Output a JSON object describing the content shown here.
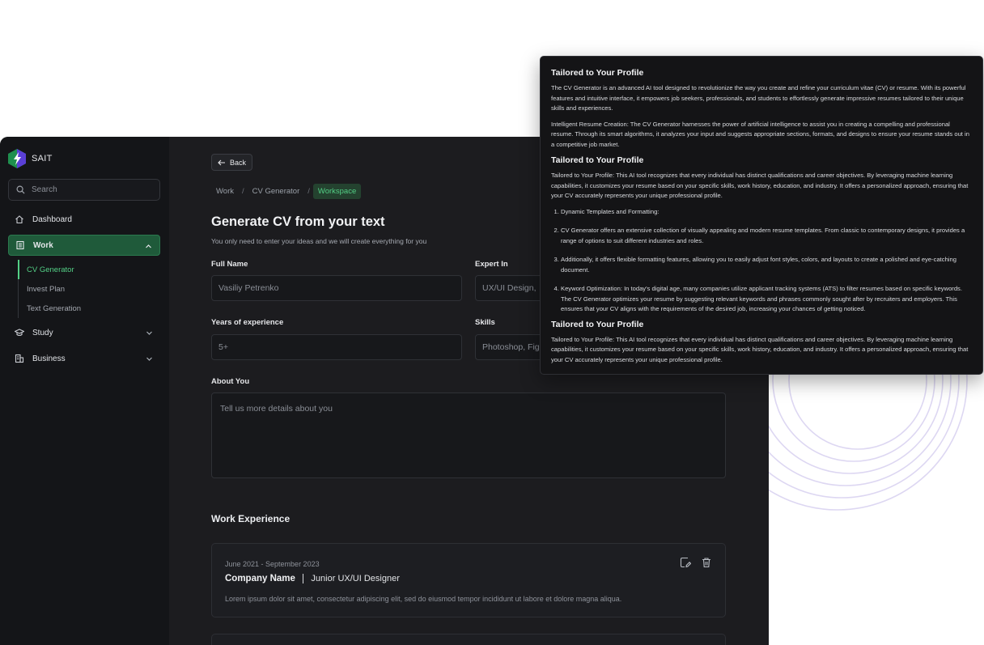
{
  "brand": {
    "name": "SAIT",
    "accent": "#53cf85"
  },
  "sidebar": {
    "search_placeholder": "Search",
    "items": [
      {
        "label": "Dashboard",
        "icon": "home-icon"
      },
      {
        "label": "Work",
        "icon": "building-icon",
        "expanded": true,
        "children": [
          {
            "label": "CV Generator",
            "active": true
          },
          {
            "label": "Invest Plan"
          },
          {
            "label": "Text Generation"
          }
        ]
      },
      {
        "label": "Study",
        "icon": "graduation-cap-icon"
      },
      {
        "label": "Business",
        "icon": "office-building-icon"
      }
    ]
  },
  "main": {
    "back_label": "Back",
    "breadcrumbs": [
      "Work",
      "CV Generator",
      "Workspace"
    ],
    "title": "Generate CV from your text",
    "subtitle": "You only need to enter your ideas and we will create everything for you",
    "form": {
      "full_name": {
        "label": "Full Name",
        "placeholder": "Vasiliy Petrenko"
      },
      "expert_in": {
        "label": "Expert In",
        "placeholder": "UX/UI Design, "
      },
      "years": {
        "label": "Years of experience",
        "placeholder": "5+"
      },
      "skills": {
        "label": "Skills",
        "placeholder": "Photoshop, Fig"
      },
      "about": {
        "label": "About You",
        "placeholder": "Tell us more details about you"
      }
    },
    "work_experience": {
      "title": "Work Experience",
      "items": [
        {
          "dates": "June 2021 - September 2023",
          "company": "Company Name",
          "role": "Junior UX/UI Designer",
          "description": "Lorem ipsum dolor sit amet, consectetur adipiscing elit, sed do eiusmod tempor incididunt ut labore et dolore magna aliqua."
        }
      ]
    }
  },
  "panel": {
    "h1": "Tailored to Your Profile",
    "p1": "The CV Generator is an advanced AI tool designed to revolutionize the way you create and refine your curriculum vitae (CV) or resume. With its powerful features and intuitive interface, it empowers job seekers, professionals, and students to effortlessly generate impressive resumes tailored to their unique skills and experiences.",
    "p2": "Intelligent Resume Creation: The CV Generator harnesses the power of artificial intelligence to assist you in creating a compelling and professional resume. Through its smart algorithms, it analyzes your input and suggests appropriate sections, formats, and designs to ensure your resume stands out in a competitive job market.",
    "h2": "Tailored to Your Profile",
    "p3": "Tailored to Your Profile: This AI tool recognizes that every individual has distinct qualifications and career objectives. By leveraging machine learning capabilities, it customizes your resume based on your specific skills, work history, education, and industry. It offers a personalized approach, ensuring that your CV accurately represents your unique professional profile.",
    "list": [
      "Dynamic Templates and Formatting:",
      " CV Generator offers an extensive collection of visually appealing and modern resume templates. From classic to contemporary designs, it provides a range of options to suit different industries and roles.",
      "Additionally, it offers flexible formatting features, allowing you to easily adjust font styles, colors, and layouts to create a polished and eye-catching document.",
      "Keyword Optimization: In today's digital age, many companies utilize applicant tracking systems (ATS) to filter resumes based on specific keywords. The CV Generator optimizes your resume by suggesting relevant keywords and phrases commonly sought after by recruiters and employers. This ensures that your CV aligns with the requirements of the desired job, increasing your chances of getting noticed."
    ],
    "h3": "Tailored to Your Profile",
    "p4": "Tailored to Your Profile: This AI tool recognizes that every individual has distinct qualifications and career objectives. By leveraging machine learning capabilities, it customizes your resume based on your specific skills, work history, education, and industry. It offers a personalized approach, ensuring that your CV accurately represents your unique professional profile."
  }
}
